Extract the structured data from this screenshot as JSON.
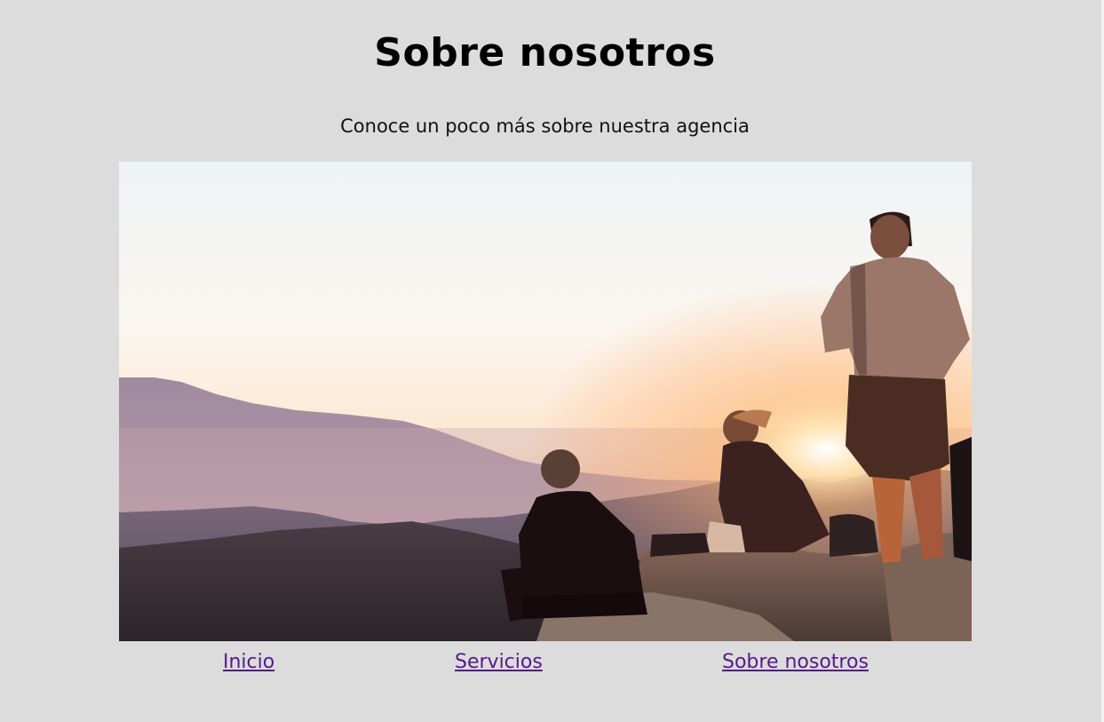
{
  "page": {
    "title": "Sobre nosotros",
    "subtitle": "Conoce un poco más sobre nuestra agencia"
  },
  "hero_image": {
    "icon": "photo-people-watching-sunset-over-mountains"
  },
  "nav": {
    "links": [
      {
        "label": "Inicio"
      },
      {
        "label": "Servicios"
      },
      {
        "label": "Sobre nosotros"
      }
    ],
    "link_color": "#551a8b"
  },
  "colors": {
    "background": "#dcdcdc",
    "text": "#000000"
  }
}
